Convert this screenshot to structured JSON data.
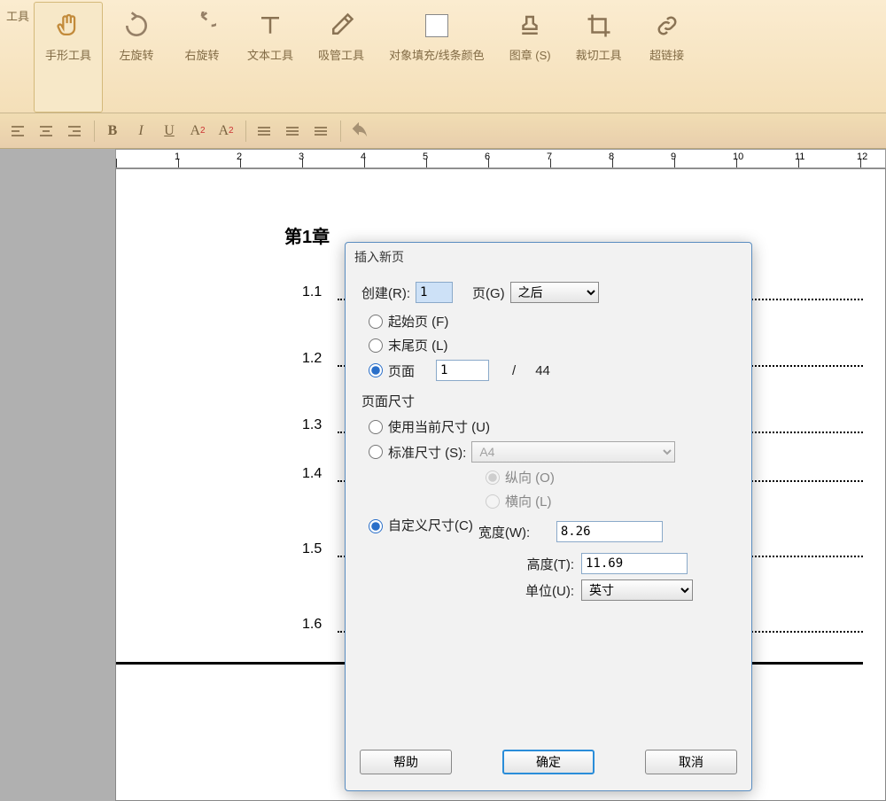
{
  "toolbar": {
    "items": [
      {
        "label": "工具"
      },
      {
        "label": "手形工具"
      },
      {
        "label": "左旋转"
      },
      {
        "label": "右旋转"
      },
      {
        "label": "文本工具"
      },
      {
        "label": "吸管工具"
      },
      {
        "label": "对象填充/线条颜色"
      },
      {
        "label": "图章 (S)"
      },
      {
        "label": "裁切工具"
      },
      {
        "label": "超链接"
      }
    ]
  },
  "doc": {
    "title": "第1章",
    "toc": [
      "1.1",
      "1.2",
      "1.3",
      "1.4",
      "1.5",
      "1.6"
    ]
  },
  "dialog": {
    "title": "插入新页",
    "create_label": "创建(R):",
    "create_value": "1",
    "page_suffix": "页(G)",
    "position_value": "之后",
    "first_page": "起始页 (F)",
    "last_page": "末尾页 (L)",
    "page_label": "页面",
    "page_num": "1",
    "page_sep": "/",
    "page_total": "44",
    "size_section": "页面尺寸",
    "use_current": "使用当前尺寸 (U)",
    "standard": "标准尺寸 (S):",
    "standard_value": "A4",
    "portrait": "纵向 (O)",
    "landscape": "横向 (L)",
    "custom": "自定义尺寸(C)",
    "width_label": "宽度(W):",
    "width_value": "8.26",
    "height_label": "高度(T):",
    "height_value": "11.69",
    "unit_label": "单位(U):",
    "unit_value": "英寸",
    "help": "帮助",
    "ok": "确定",
    "cancel": "取消"
  }
}
